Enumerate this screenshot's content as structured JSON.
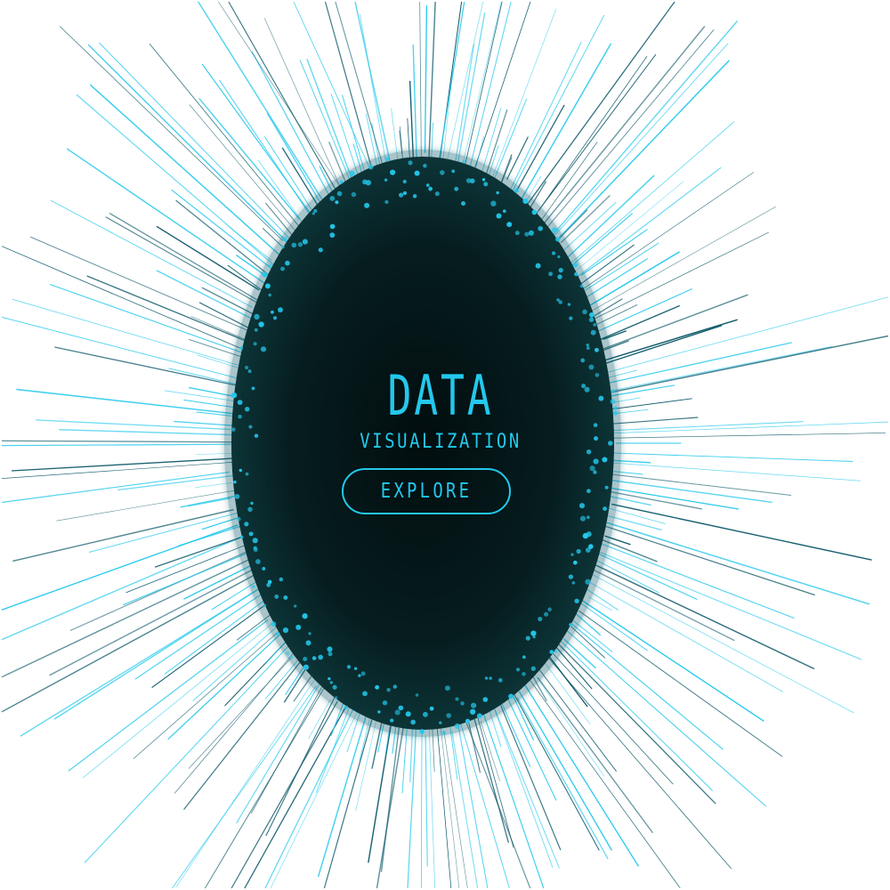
{
  "hero": {
    "title": "DATA",
    "subtitle": "VISUALIZATION"
  },
  "cta": {
    "label": "EXPLORE"
  },
  "colors": {
    "background": "#ffffff",
    "core_dark": "#041617",
    "core_teal": "#0b3436",
    "accent_cyan": "#23c8ec",
    "line_dark_teal": "#0f5a6a"
  },
  "decoration": {
    "style": "radial-line-burst-with-dots"
  }
}
